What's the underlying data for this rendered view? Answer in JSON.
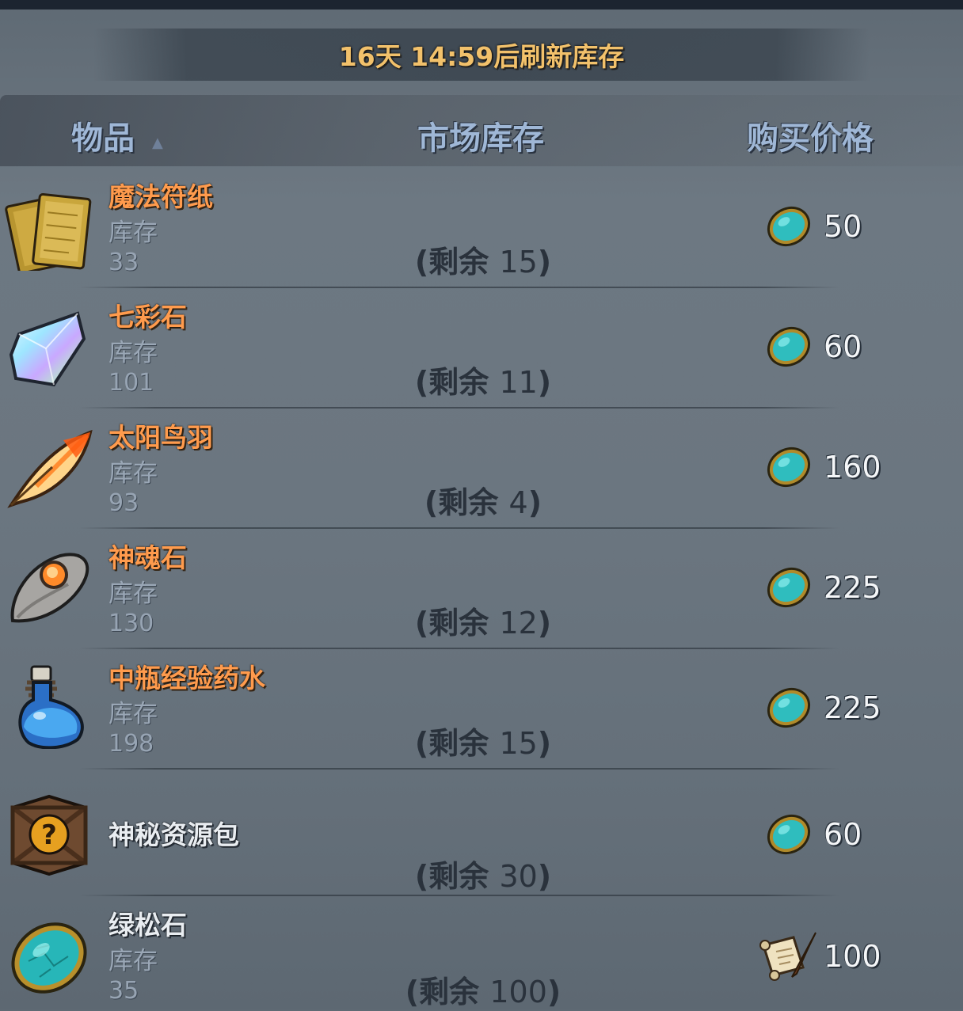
{
  "banner": {
    "text": "16天 14:59后刷新库存"
  },
  "header": {
    "item_label": "物品",
    "sort_icon": "triangle-up",
    "stock_label": "市场库存",
    "price_label": "购买价格"
  },
  "rows": [
    {
      "name": "魔法符纸",
      "stock_label": "库存",
      "stock": "33",
      "remain_prefix": "(剩余 ",
      "remain_num": "15",
      "remain_suffix": ")",
      "price": "50",
      "currency_icon": "turquoise-gem-icon",
      "item_icon": "magic-paper-icon"
    },
    {
      "name": "七彩石",
      "stock_label": "库存",
      "stock": "101",
      "remain_prefix": "(剩余 ",
      "remain_num": "11",
      "remain_suffix": ")",
      "price": "60",
      "currency_icon": "turquoise-gem-icon",
      "item_icon": "rainbow-crystal-icon"
    },
    {
      "name": "太阳鸟羽",
      "stock_label": "库存",
      "stock": "93",
      "remain_prefix": "(剩余 ",
      "remain_num": "4",
      "remain_suffix": ")",
      "price": "160",
      "currency_icon": "turquoise-gem-icon",
      "item_icon": "feather-icon"
    },
    {
      "name": "神魂石",
      "stock_label": "库存",
      "stock": "130",
      "remain_prefix": "(剩余 ",
      "remain_num": "12",
      "remain_suffix": ")",
      "price": "225",
      "currency_icon": "turquoise-gem-icon",
      "item_icon": "soul-stone-icon"
    },
    {
      "name": "中瓶经验药水",
      "stock_label": "库存",
      "stock": "198",
      "remain_prefix": "(剩余 ",
      "remain_num": "15",
      "remain_suffix": ")",
      "price": "225",
      "currency_icon": "turquoise-gem-icon",
      "item_icon": "potion-icon"
    },
    {
      "name": "神秘资源包",
      "stock_label": "",
      "stock": "",
      "remain_prefix": "(剩余 ",
      "remain_num": "30",
      "remain_suffix": ")",
      "price": "60",
      "currency_icon": "turquoise-gem-icon",
      "item_icon": "mystery-crate-icon"
    },
    {
      "name": "绿松石",
      "stock_label": "库存",
      "stock": "35",
      "remain_prefix": "(剩余 ",
      "remain_num": "100",
      "remain_suffix": ")",
      "price": "100",
      "currency_icon": "scroll-quill-icon",
      "item_icon": "turquoise-gem-icon"
    }
  ]
}
